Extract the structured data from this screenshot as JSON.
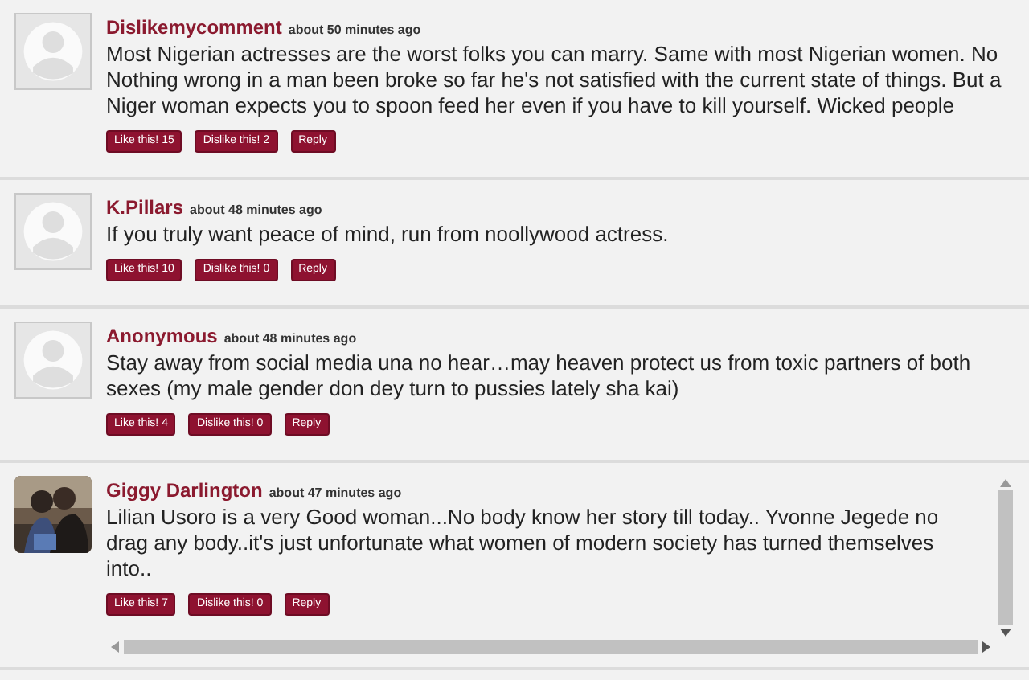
{
  "comments": [
    {
      "author": "Dislikemycomment",
      "time": "about 50 minutes ago",
      "avatar": {
        "kind": "placeholder"
      },
      "text": "Most Nigerian actresses are the worst folks you can marry. Same with most Nigerian women. No Nothing wrong in a man been broke so far he's not satisfied with the current state of things. But a Niger woman expects you to spoon feed her even if you have to kill yourself. Wicked people",
      "buttons": [
        "Like this! 15",
        "Dislike this! 2",
        "Reply"
      ],
      "scrollable": false
    },
    {
      "author": "K.Pillars",
      "time": "about 48 minutes ago",
      "avatar": {
        "kind": "placeholder"
      },
      "text": "If you truly want peace of mind, run from noollywood actress.",
      "buttons": [
        "Like this! 10",
        "Dislike this! 0",
        "Reply"
      ],
      "scrollable": false
    },
    {
      "author": "Anonymous",
      "time": "about 48 minutes ago",
      "avatar": {
        "kind": "placeholder"
      },
      "text": "Stay away from social media una no hear…may heaven protect us from toxic partners of both sexes (my male gender don dey turn to pussies lately sha kai)",
      "buttons": [
        "Like this! 4",
        "Dislike this! 0",
        "Reply"
      ],
      "scrollable": false
    },
    {
      "author": "Giggy Darlington",
      "time": "about 47 minutes ago",
      "avatar": {
        "kind": "picture"
      },
      "text": "Lilian Usoro is a very Good woman...No body know her story till today.. Yvonne Jegede no drag any body..it's just unfortunate what women of modern society has turned themselves into..",
      "buttons": [
        "Like this! 7",
        "Dislike this! 0",
        "Reply"
      ],
      "scrollable": true
    }
  ]
}
